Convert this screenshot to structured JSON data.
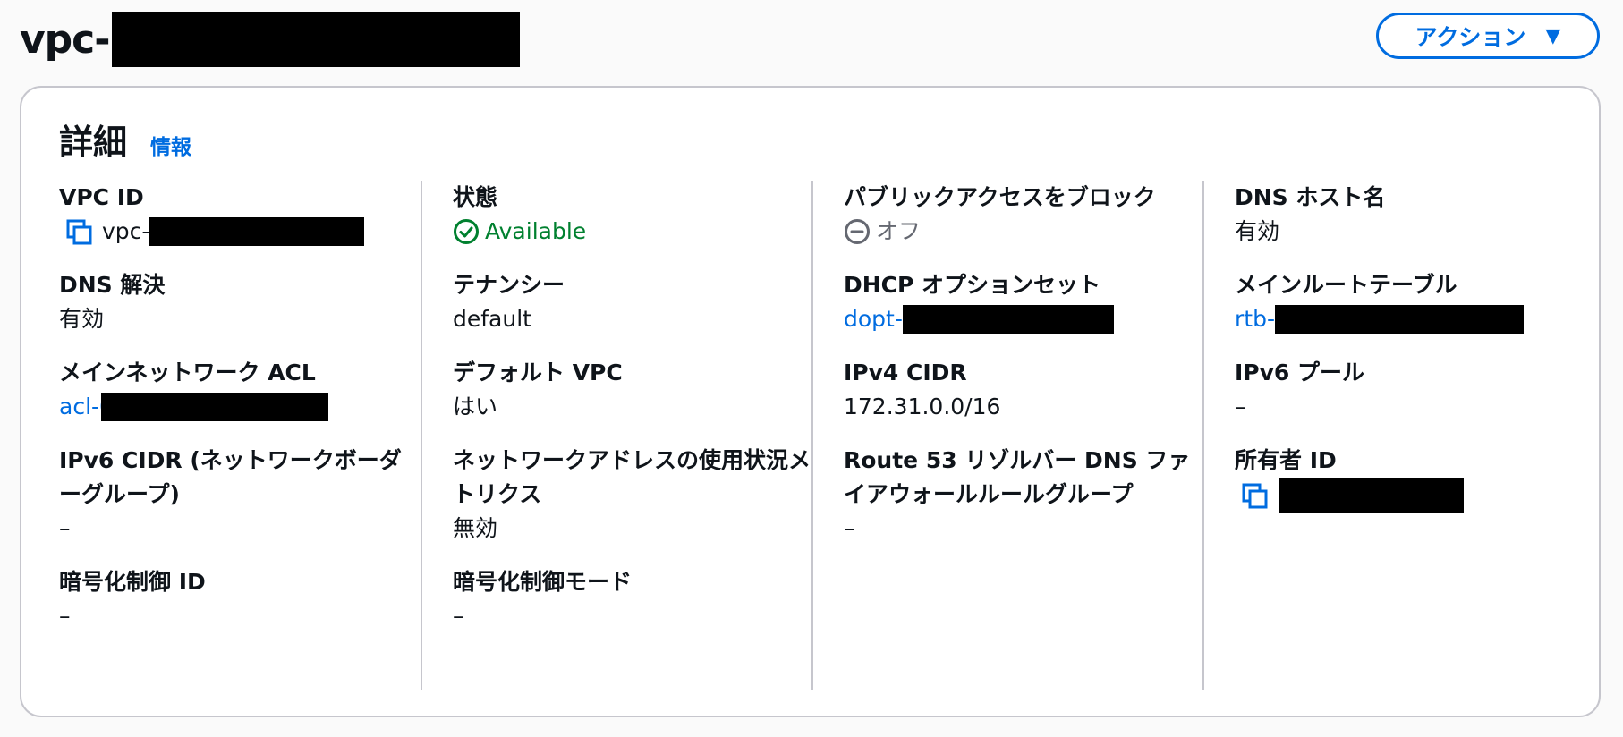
{
  "header": {
    "title": "vpc-",
    "actions_label": "アクション",
    "actions_caret": "▼"
  },
  "details": {
    "title": "詳細",
    "info_label": "情報",
    "col1": {
      "vpc_id_label": "VPC ID",
      "vpc_id_value": "vpc-",
      "dns_resolution_label": "DNS 解決",
      "dns_resolution_value": "有効",
      "main_acl_label": "メインネットワーク ACL",
      "main_acl_value": "acl-0",
      "ipv6_cidr_label": "IPv6 CIDR (ネットワークボーダーグループ)",
      "ipv6_cidr_value": "–",
      "encryption_id_label": "暗号化制御 ID",
      "encryption_id_value": "–"
    },
    "col2": {
      "state_label": "状態",
      "state_value": "Available",
      "tenancy_label": "テナンシー",
      "tenancy_value": "default",
      "default_vpc_label": "デフォルト VPC",
      "default_vpc_value": "はい",
      "net_usage_label": "ネットワークアドレスの使用状況メトリクス",
      "net_usage_value": "無効",
      "encryption_mode_label": "暗号化制御モード",
      "encryption_mode_value": "–"
    },
    "col3": {
      "block_public_label": "パブリックアクセスをブロック",
      "block_public_value": "オフ",
      "dhcp_label": "DHCP オプションセット",
      "dhcp_value": "dopt-",
      "ipv4_cidr_label": "IPv4 CIDR",
      "ipv4_cidr_value": "172.31.0.0/16",
      "route53_label": "Route 53 リゾルバー DNS ファイアウォールルールグループ",
      "route53_value": "–"
    },
    "col4": {
      "dns_hostnames_label": "DNS ホスト名",
      "dns_hostnames_value": "有効",
      "main_route_table_label": "メインルートテーブル",
      "main_route_table_value": "rtb-",
      "ipv6_pool_label": "IPv6 プール",
      "ipv6_pool_value": "–",
      "owner_id_label": "所有者 ID"
    }
  },
  "colors": {
    "link": "#006ce0",
    "success": "#00802f",
    "muted": "#656871",
    "border": "#c6c6cd"
  },
  "icons": {
    "copy": "copy-icon",
    "status_ok": "status-positive-icon",
    "status_off": "status-stopped-icon",
    "caret": "caret-down-icon"
  }
}
